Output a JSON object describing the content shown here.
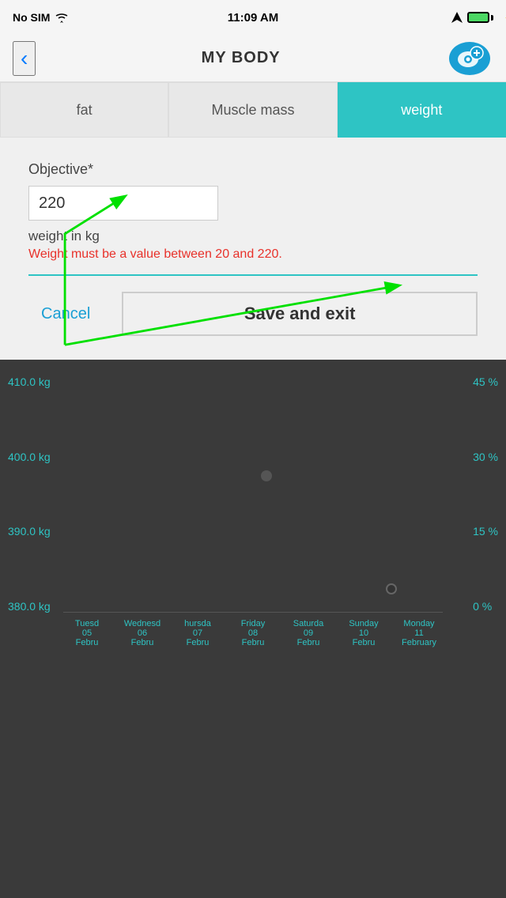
{
  "statusBar": {
    "carrier": "No SIM",
    "time": "11:09 AM"
  },
  "header": {
    "title": "MY BODY",
    "backLabel": "<",
    "addIconAlt": "add-icon"
  },
  "tabs": [
    {
      "id": "fat",
      "label": "fat",
      "active": false
    },
    {
      "id": "muscle",
      "label": "Muscle mass",
      "active": false
    },
    {
      "id": "weight",
      "label": "weight",
      "active": true
    }
  ],
  "form": {
    "objectiveLabel": "Objective*",
    "inputValue": "220",
    "weightUnitLabel": "weight in kg",
    "errorText": "Weight must be a value between 20 and 220.",
    "cancelLabel": "Cancel",
    "saveLabel": "Save and exit"
  },
  "chart": {
    "yLabelsLeft": [
      "410.0 kg",
      "400.0 kg",
      "390.0 kg",
      "380.0 kg"
    ],
    "yLabelsRight": [
      "45 %",
      "30 %",
      "15 %",
      "0 %"
    ],
    "xLabels": [
      {
        "day": "Tuesday",
        "abbr": "Tuesd",
        "date": "05",
        "month": "Febru"
      },
      {
        "day": "Wednesday",
        "abbr": "Wednesd",
        "date": "06",
        "month": "Febru"
      },
      {
        "day": "Thursday",
        "abbr": "hursda",
        "date": "07",
        "month": "Febru"
      },
      {
        "day": "Friday",
        "abbr": "Friday",
        "date": "08",
        "month": "Febru"
      },
      {
        "day": "Saturday",
        "abbr": "Saturda",
        "date": "09",
        "month": "Febru"
      },
      {
        "day": "Sunday",
        "abbr": "Sunday",
        "date": "10",
        "month": "Febru"
      },
      {
        "day": "Monday",
        "abbr": "Monday",
        "date": "11",
        "month": "February"
      }
    ]
  }
}
